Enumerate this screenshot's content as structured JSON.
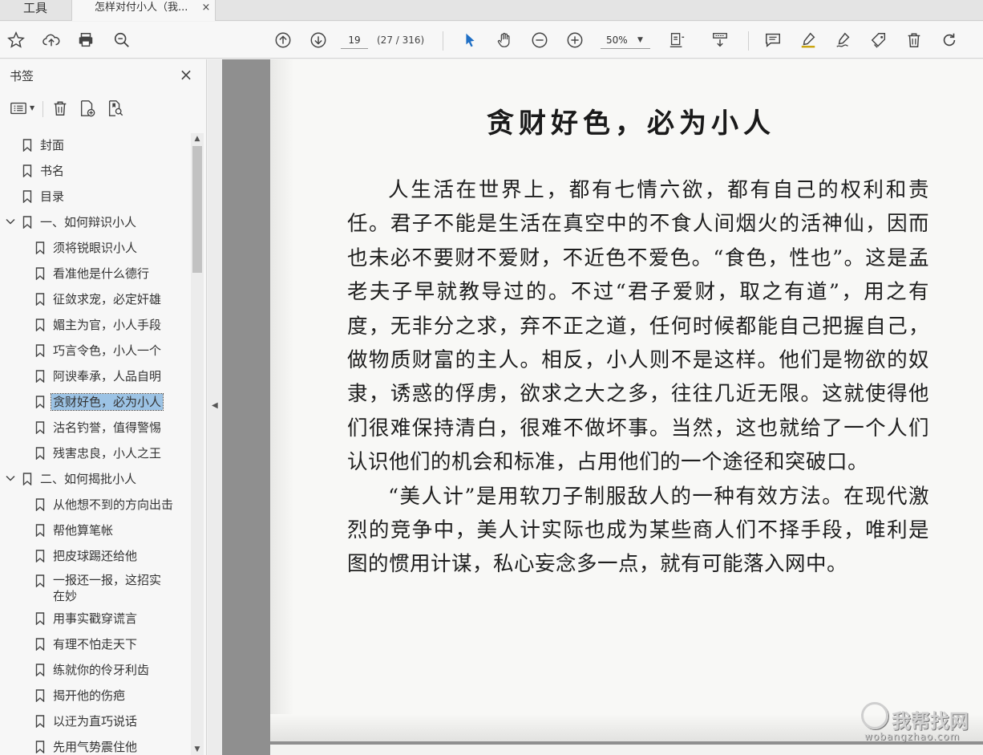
{
  "tabs": {
    "tools_label": "工具",
    "doc_label": "怎样对付小人（我...",
    "close_glyph": "×"
  },
  "toolbar": {
    "page_number": "19",
    "page_count": "(27 / 316)",
    "zoom": "50%",
    "icons": [
      "star-icon",
      "cloud-upload-icon",
      "print-icon",
      "zoom-search-icon",
      "arrow-up-circle-icon",
      "arrow-down-circle-icon",
      "select-arrow-icon",
      "hand-icon",
      "zoom-out-icon",
      "zoom-in-icon",
      "fit-page-icon",
      "scroll-mode-icon",
      "comment-icon",
      "highlight-pen-icon",
      "draw-signature-icon",
      "tag-icon",
      "delete-icon",
      "rotate-icon"
    ],
    "accent_color": "#1f6fc5"
  },
  "sidebar": {
    "title": "书签",
    "close_glyph": "×",
    "bookmarks": [
      {
        "label": "封面"
      },
      {
        "label": "书名"
      },
      {
        "label": "目录"
      },
      {
        "label": "一、如何辩识小人"
      },
      {
        "label": "须将锐眼识小人"
      },
      {
        "label": "看准他是什么德行"
      },
      {
        "label": "征敛求宠，必定奸雄"
      },
      {
        "label": "媚主为官，小人手段"
      },
      {
        "label": "巧言令色，小人一个"
      },
      {
        "label": "阿谀奉承，人品自明"
      },
      {
        "label": "贪财好色，必为小人"
      },
      {
        "label": "沽名钓誉，值得警惕"
      },
      {
        "label": "残害忠良，小人之王"
      },
      {
        "label": "二、如何揭批小人"
      },
      {
        "label": "从他想不到的方向出击"
      },
      {
        "label": "帮他算笔帐"
      },
      {
        "label": "把皮球踢还给他"
      },
      {
        "label": "一报还一报，这招实在妙"
      },
      {
        "label": "用事实戳穿谎言"
      },
      {
        "label": "有理不怕走天下"
      },
      {
        "label": "练就你的伶牙利齿"
      },
      {
        "label": "揭开他的伤疤"
      },
      {
        "label": "以迂为直巧说话"
      },
      {
        "label": "先用气势震住他"
      }
    ],
    "selected_color": "#9cc3e5"
  },
  "document": {
    "title": "贪财好色，必为小人",
    "paragraph_1": "人生活在世界上，都有七情六欲，都有自己的权利和责任。君子不能是生活在真空中的不食人间烟火的活神仙，因而也未必不要财不爱财，不近色不爱色。“食色，性也”。这是孟老夫子早就教导过的。不过“君子爱财，取之有道”，用之有度，无非分之求，弃不正之道，任何时候都能自己把握自己，做物质财富的主人。相反，小人则不是这样。他们是物欲的奴隶，诱惑的俘虏，欲求之大之多，往往几近无限。这就使得他们很难保持清白，很难不做坏事。当然，这也就给了一个人们认识他们的机会和标准，占用他们的一个途径和突破口。",
    "paragraph_2": "“美人计”是用软刀子制服敌人的一种有效方法。在现代激烈的竞争中，美人计实际也成为某些商人们不择手段，唯利是图的惯用计谋，私心妄念多一点，就有可能落入网中。"
  },
  "watermark": {
    "main": "我帮找网",
    "sub": "wobangzhao.com"
  }
}
